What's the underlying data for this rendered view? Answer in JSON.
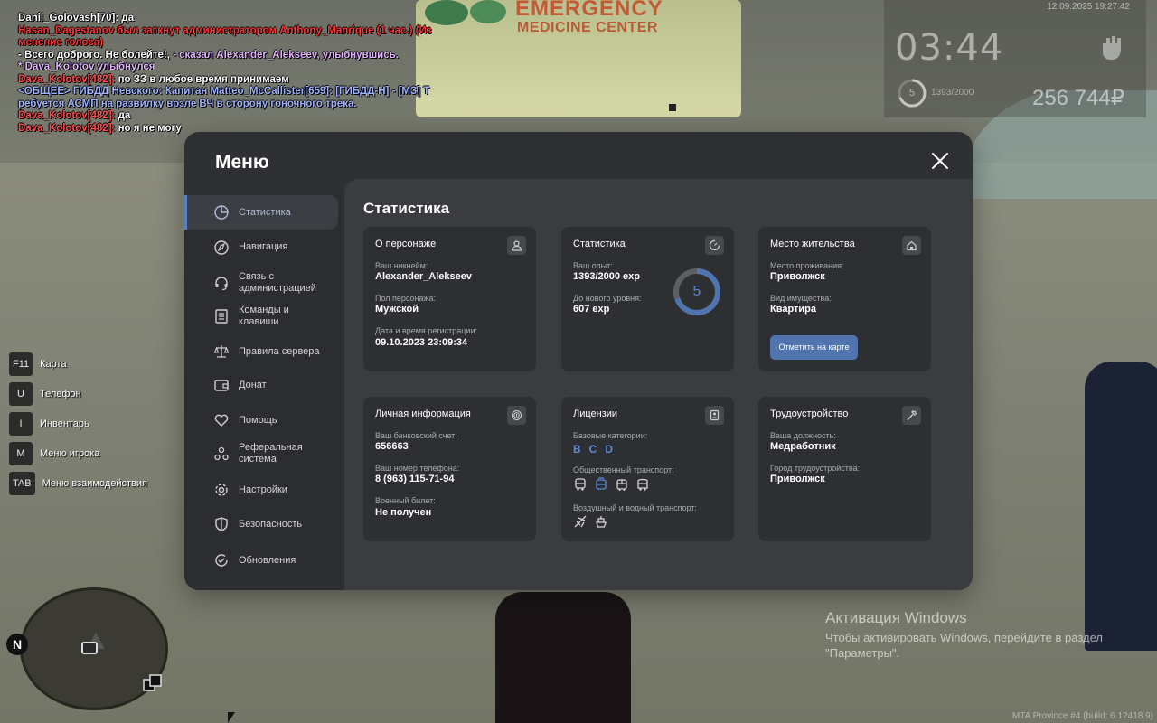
{
  "chat": [
    [
      {
        "t": "Danil_Golovash[70]: да",
        "c": "white"
      }
    ],
    [
      {
        "t": "Hasan_Dagestanov был заткнут администратором Anthony_Manrique (1 час.) (Из",
        "c": "red"
      }
    ],
    [
      {
        "t": "менение голоса)",
        "c": "red"
      }
    ],
    [
      {
        "t": "- Всего доброго. Не болейте!, ",
        "c": "white"
      },
      {
        "t": "- сказал Alexander_Alekseev, улыбнувшись.",
        "c": "lav"
      }
    ],
    [
      {
        "t": "* Dava_Kolotov улыбнулся",
        "c": "lav"
      }
    ],
    [
      {
        "t": "Dava_Kolotov[482]: ",
        "c": "pink"
      },
      {
        "t": "по ЗЗ в любое время принимаем",
        "c": "white"
      }
    ],
    [
      {
        "t": "<ОБЩЕЕ> ГИБДД Невского: Капитан Matteo_McCallister[659]: [ГИБДД-Н] - [МЗ] Т",
        "c": "blue"
      }
    ],
    [
      {
        "t": "ребуется АСМП на развилку возле ВЧ в сторону гоночного трека.",
        "c": "blue"
      }
    ],
    [
      {
        "t": "Dava_Kolotov[482]: ",
        "c": "pink"
      },
      {
        "t": "да",
        "c": "white"
      }
    ],
    [
      {
        "t": "Dava_Kolotov[482]: ",
        "c": "pink"
      },
      {
        "t": "но я не могу",
        "c": "white"
      }
    ]
  ],
  "hud": {
    "date": "12.09.2025 19:27:42",
    "time": "03:44",
    "level": "5",
    "exp": "1393/2000",
    "money": "256 744₽"
  },
  "world": {
    "sign_line1": "EMERGENCY",
    "sign_line2": "MEDICINE CENTER"
  },
  "keybinds": [
    {
      "key": "F11",
      "label": "Карта"
    },
    {
      "key": "U",
      "label": "Телефон"
    },
    {
      "key": "I",
      "label": "Инвентарь"
    },
    {
      "key": "M",
      "label": "Меню игрока"
    },
    {
      "key": "TAB",
      "label": "Меню взаимодействия"
    }
  ],
  "minimap": {
    "north": "N"
  },
  "menu": {
    "title": "Меню",
    "close_icon": "close-icon",
    "sidebar": [
      {
        "label": "Статистика",
        "icon": "pie-chart-icon",
        "active": true
      },
      {
        "label": "Навигация",
        "icon": "compass-icon",
        "active": false
      },
      {
        "label": "Связь с администрацией",
        "icon": "headset-icon",
        "active": false
      },
      {
        "label": "Команды и клавиши",
        "icon": "list-icon",
        "active": false
      },
      {
        "label": "Правила сервера",
        "icon": "scales-icon",
        "active": false
      },
      {
        "label": "Донат",
        "icon": "wallet-icon",
        "active": false
      },
      {
        "label": "Помощь",
        "icon": "handshake-heart-icon",
        "active": false
      },
      {
        "label": "Реферальная система",
        "icon": "users-icon",
        "active": false
      },
      {
        "label": "Настройки",
        "icon": "gear-icon",
        "active": false
      },
      {
        "label": "Безопасность",
        "icon": "shield-icon",
        "active": false
      },
      {
        "label": "Обновления",
        "icon": "refresh-check-icon",
        "active": false
      }
    ],
    "content_title": "Статистика",
    "cards": {
      "character": {
        "title": "О персонаже",
        "icon": "user-icon",
        "nickname_label": "Ваш никнейм:",
        "nickname": "Alexander_Alekseev",
        "gender_label": "Пол персонажа:",
        "gender": "Мужской",
        "reg_label": "Дата и время регистрации:",
        "reg": "09.10.2023 23:09:34"
      },
      "stats": {
        "title": "Статистика",
        "icon": "gauge-icon",
        "exp_label": "Ваш опыт:",
        "exp": "1393/2000 exp",
        "next_label": "До нового уровня:",
        "next": "607 exp",
        "level": "5",
        "level_progress": 0.6965
      },
      "residence": {
        "title": "Место жительства",
        "icon": "home-icon",
        "city_label": "Место проживания:",
        "city": "Приволжск",
        "property_label": "Вид имущества:",
        "property": "Квартира",
        "button": "Отметить на карте"
      },
      "personal": {
        "title": "Личная информация",
        "icon": "fingerprint-icon",
        "bank_label": "Ваш банковский счет:",
        "bank": "656663",
        "phone_label": "Ваш номер телефона:",
        "phone": "8 (963) 115-71-94",
        "military_label": "Военный билет:",
        "military": "Не получен"
      },
      "licenses": {
        "title": "Лицензии",
        "icon": "id-card-icon",
        "base_label": "Базовые категории:",
        "categories": [
          "B",
          "C",
          "D"
        ],
        "public_label": "Общественный транспорт:",
        "public_icons": [
          "bus-icon",
          "tram-icon",
          "trolleybus-icon",
          "coach-icon"
        ],
        "air_label": "Воздушный и водный транспорт:",
        "air_icons": [
          "plane-icon",
          "boat-icon"
        ]
      },
      "job": {
        "title": "Трудоустройство",
        "icon": "hammer-icon",
        "position_label": "Ваша должность:",
        "position": "Медработник",
        "city_label": "Город трудоустройства:",
        "city": "Приволжск"
      }
    }
  },
  "windows": {
    "title": "Активация Windows",
    "subtitle": "Чтобы активировать Windows, перейдите в раздел \"Параметры\"."
  },
  "build": "MTA Province #4 (build: 6.12418.9)"
}
